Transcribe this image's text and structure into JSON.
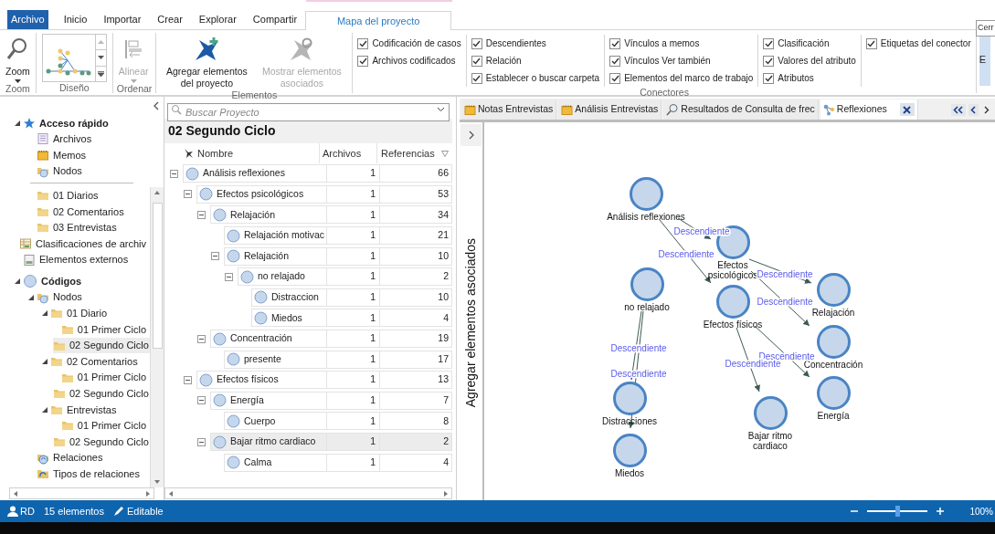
{
  "ribbon": {
    "tabs": [
      {
        "label": "Archivo",
        "kind": "file",
        "selected": false
      },
      {
        "label": "Inicio",
        "kind": "tab",
        "selected": false
      },
      {
        "label": "Importar",
        "kind": "tab",
        "selected": false
      },
      {
        "label": "Crear",
        "kind": "tab",
        "selected": false
      },
      {
        "label": "Explorar",
        "kind": "tab",
        "selected": false
      },
      {
        "label": "Compartir",
        "kind": "tab",
        "selected": false
      },
      {
        "label": "Mapa del proyecto",
        "kind": "context",
        "selected": true
      }
    ],
    "groups": [
      {
        "label": "Zoom",
        "kind": "buttons",
        "buttons": [
          {
            "label": "Zoom",
            "disabled": false,
            "dropdown": true
          }
        ]
      },
      {
        "label": "Diseño",
        "kind": "gallery"
      },
      {
        "label": "Ordenar",
        "kind": "buttons",
        "buttons": [
          {
            "label": "Alinear",
            "disabled": true,
            "dropdown": true
          }
        ]
      },
      {
        "label": "Elementos",
        "kind": "buttons",
        "buttons": [
          {
            "label": "Agregar elementos del proyecto",
            "disabled": false,
            "dropdown": false
          },
          {
            "label": "Mostrar elementos asociados",
            "disabled": true,
            "dropdown": false
          }
        ]
      },
      {
        "label": "Conectores",
        "kind": "checks",
        "columns": [
          [
            {
              "label": "Codificación de casos",
              "checked": true
            },
            {
              "label": "Archivos codificados",
              "checked": true
            }
          ],
          [
            {
              "label": "Descendientes",
              "checked": true
            },
            {
              "label": "Relación",
              "checked": true
            },
            {
              "label": "Establecer o buscar carpeta",
              "checked": true
            }
          ],
          [
            {
              "label": "Vínculos a memos",
              "checked": true
            },
            {
              "label": "Vínculos Ver también",
              "checked": true
            },
            {
              "label": "Elementos del marco de trabajo",
              "checked": true
            }
          ],
          [
            {
              "label": "Clasificación",
              "checked": true
            },
            {
              "label": "Valores del atributo",
              "checked": true
            },
            {
              "label": "Atributos",
              "checked": true
            }
          ],
          [
            {
              "label": "Etiquetas del conector",
              "checked": true
            }
          ]
        ]
      }
    ],
    "overflow_button": {
      "label": "E"
    },
    "tooltip": {
      "text": "Cerr"
    }
  },
  "navigation": {
    "tree": [
      {
        "label": "Acceso rápido",
        "kind": "quick",
        "expanded": true,
        "selected": false,
        "children": [
          {
            "label": "Archivos",
            "kind": "files",
            "selected": false
          },
          {
            "label": "Memos",
            "kind": "memos",
            "selected": false
          },
          {
            "label": "Nodos",
            "kind": "nodes",
            "selected": false
          }
        ]
      },
      {
        "kind": "continuation",
        "children": [
          {
            "kind": "continuation",
            "children": [
              {
                "label": "01 Diarios",
                "kind": "folder",
                "selected": false
              },
              {
                "label": "02 Comentarios",
                "kind": "folder",
                "selected": false
              },
              {
                "label": "03 Entrevistas",
                "kind": "folder",
                "selected": false
              }
            ]
          },
          {
            "label": "Clasificaciones de archiv",
            "kind": "classification",
            "selected": false
          },
          {
            "label": "Elementos externos",
            "kind": "external",
            "selected": false
          }
        ]
      },
      {
        "label": "Códigos",
        "kind": "codes",
        "expanded": true,
        "selected": false,
        "children": [
          {
            "label": "Nodos",
            "kind": "nodes",
            "expanded": true,
            "selected": false,
            "children": [
              {
                "label": "01 Diario",
                "kind": "folder",
                "expanded": true,
                "selected": false,
                "children": [
                  {
                    "label": "01 Primer Ciclo",
                    "kind": "folder",
                    "selected": false
                  },
                  {
                    "label": "02 Segundo Ciclo",
                    "kind": "folder",
                    "selected": true
                  }
                ]
              },
              {
                "label": "02 Comentarios",
                "kind": "folder",
                "expanded": true,
                "selected": false,
                "children": [
                  {
                    "label": "01 Primer Ciclo",
                    "kind": "folder",
                    "selected": false
                  },
                  {
                    "label": "02 Segundo Ciclo",
                    "kind": "folder",
                    "selected": false
                  }
                ]
              },
              {
                "label": "Entrevistas",
                "kind": "folder",
                "expanded": true,
                "selected": false,
                "children": [
                  {
                    "label": "01 Primer Ciclo",
                    "kind": "folder",
                    "selected": false
                  },
                  {
                    "label": "02 Segundo Ciclo",
                    "kind": "folder",
                    "selected": false
                  }
                ]
              }
            ]
          },
          {
            "label": "Relaciones",
            "kind": "relations",
            "selected": false
          },
          {
            "label": "Tipos de relaciones",
            "kind": "relation-types",
            "selected": false
          }
        ]
      }
    ]
  },
  "list_view": {
    "search": {
      "placeholder": "Buscar Proyecto"
    },
    "title": "02 Segundo Ciclo",
    "columns": [
      "Nombre",
      "Archivos",
      "Referencias"
    ],
    "rows": [
      {
        "name": "Análisis reflexiones",
        "files": "1",
        "references": "66",
        "expanded": true,
        "selected": false,
        "children": [
          {
            "name": "Efectos psicológicos",
            "files": "1",
            "references": "53",
            "expanded": true,
            "selected": false,
            "children": [
              {
                "name": "Relajación",
                "files": "1",
                "references": "34",
                "expanded": true,
                "selected": false,
                "children": [
                  {
                    "name": "Relajación motivac",
                    "files": "1",
                    "references": "21",
                    "selected": false
                  },
                  {
                    "name": "Relajación",
                    "files": "1",
                    "references": "10",
                    "expanded": true,
                    "selected": false,
                    "children": [
                      {
                        "name": "no relajado",
                        "files": "1",
                        "references": "2",
                        "expanded": true,
                        "selected": false,
                        "children": [
                          {
                            "name": "Distraccion",
                            "files": "1",
                            "references": "10",
                            "selected": false
                          },
                          {
                            "name": "Miedos",
                            "files": "1",
                            "references": "4",
                            "selected": false
                          }
                        ]
                      }
                    ]
                  }
                ]
              },
              {
                "name": "Concentración",
                "files": "1",
                "references": "19",
                "expanded": true,
                "selected": false,
                "children": [
                  {
                    "name": "presente",
                    "files": "1",
                    "references": "17",
                    "selected": false
                  }
                ]
              }
            ]
          },
          {
            "name": "Efectos físicos",
            "files": "1",
            "references": "13",
            "expanded": true,
            "selected": false,
            "children": [
              {
                "name": "Energía",
                "files": "1",
                "references": "7",
                "expanded": true,
                "selected": false,
                "children": [
                  {
                    "name": "Cuerpo",
                    "files": "1",
                    "references": "8",
                    "selected": false
                  }
                ]
              },
              {
                "name": "Bajar ritmo cardiaco",
                "files": "1",
                "references": "2",
                "expanded": true,
                "selected": true,
                "children": [
                  {
                    "name": "Calma",
                    "files": "1",
                    "references": "4",
                    "selected": false
                  }
                ]
              }
            ]
          }
        ]
      }
    ]
  },
  "detail_view": {
    "tabs": [
      {
        "label": "Notas Entrevistas",
        "kind": "memo",
        "selected": false
      },
      {
        "label": "Análisis Entrevistas",
        "kind": "memo",
        "selected": false
      },
      {
        "label": "Resultados de Consulta de frec",
        "kind": "query",
        "selected": false
      },
      {
        "label": "Reflexiones",
        "kind": "map",
        "selected": true
      }
    ],
    "side_panel": {
      "label": "Agregar elementos asociados",
      "expanded": false
    },
    "map": {
      "nodes": [
        {
          "label": "Análisis reflexiones"
        },
        {
          "label": "Efectos psicológicos"
        },
        {
          "label": "no relajado"
        },
        {
          "label": "Efectos físicos"
        },
        {
          "label": "Relajación"
        },
        {
          "label": "Concentración"
        },
        {
          "label": "Energía"
        },
        {
          "label": "Bajar ritmo cardiaco"
        },
        {
          "label": "Distracciones"
        },
        {
          "label": "Miedos"
        }
      ],
      "connectors": [
        {
          "label": "Descendiente"
        },
        {
          "label": "Descendiente"
        },
        {
          "label": "Descendiente"
        },
        {
          "label": "Descendiente"
        },
        {
          "label": "Descendiente"
        },
        {
          "label": "Descendiente"
        },
        {
          "label": "Descendiente"
        },
        {
          "label": "Descendiente"
        }
      ]
    }
  },
  "status_bar": {
    "user": "RD",
    "count": "15 elementos",
    "mode": "Editable",
    "zoom": {
      "level": 0.5,
      "reading": "100%"
    }
  }
}
